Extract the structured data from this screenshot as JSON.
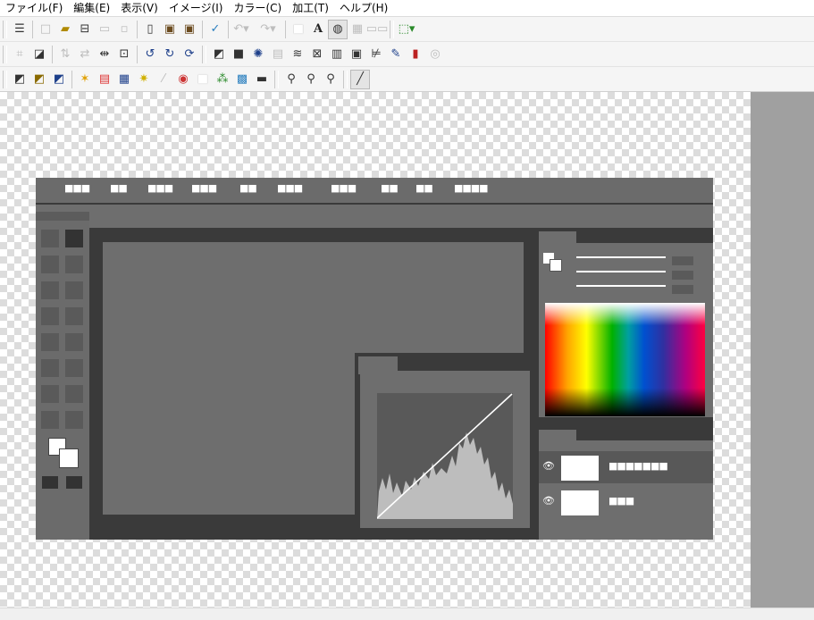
{
  "menubar": {
    "items": [
      "ファイル(F)",
      "編集(E)",
      "表示(V)",
      "イメージ(I)",
      "カラー(C)",
      "加工(T)",
      "ヘルプ(H)"
    ]
  },
  "toolbar1": {
    "icons": [
      "toolbar-menu-icon",
      "new-file-icon",
      "open-folder-icon",
      "save-icon",
      "print-icon",
      "scan-icon",
      "new-image-icon",
      "paste-icon",
      "paste-new-icon",
      "check-icon",
      "undo-icon",
      "redo-icon",
      "fill-icon",
      "text-icon",
      "filter-circle-icon",
      "grid-icon",
      "window-icon",
      "selection-icon"
    ]
  },
  "toolbar2": {
    "icons": [
      "crop-icon",
      "resize-icon",
      "flip-vertical-icon",
      "flip-horizontal-icon",
      "stretch-icon",
      "canvas-size-icon",
      "rotate-left-icon",
      "rotate-right-icon",
      "rotate-icon",
      "shadow-icon",
      "frame-icon",
      "sparkle-icon",
      "wave-icon",
      "mosaic-icon",
      "brick-icon",
      "emboss-icon",
      "edge-icon",
      "pen-icon",
      "brush-icon",
      "circle-icon"
    ]
  },
  "toolbar3": {
    "icons": [
      "gradient1-icon",
      "gradient2-icon",
      "gradient3-icon",
      "star-icon",
      "rainbow-icon",
      "color-box-icon",
      "sparkle-star-icon",
      "line-icon",
      "palette-icon",
      "white-box-icon",
      "rgb-icon",
      "picture-icon",
      "bar-icon",
      "zoom-icon",
      "zoom-in-icon",
      "zoom-out-icon",
      "ruler-icon"
    ]
  },
  "illustration": {
    "menu_dots": [
      "■■■",
      "■■",
      "■■■",
      "■■■",
      "■■",
      "■■■",
      "■■■",
      "■■",
      "■■",
      "■■■■"
    ],
    "layer1_label": "■■■■■■■",
    "layer2_label": "■■■"
  }
}
